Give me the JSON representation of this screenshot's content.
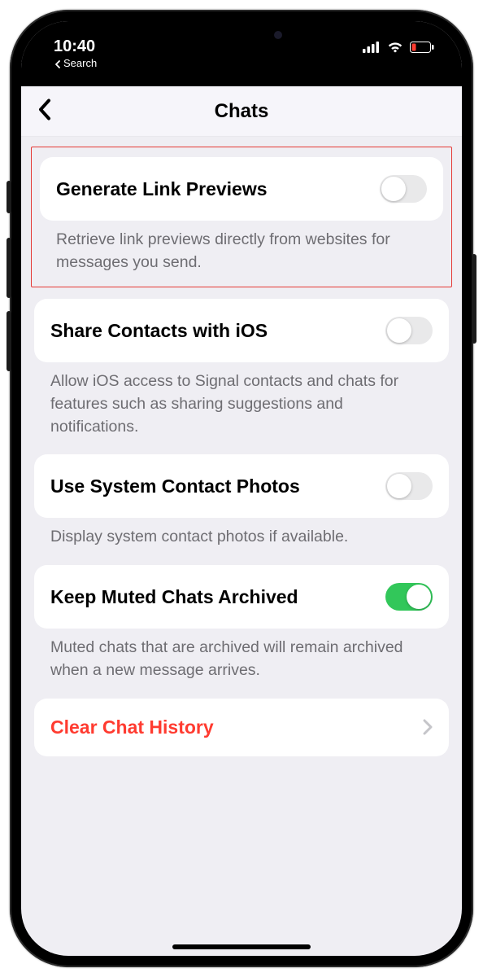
{
  "status": {
    "time": "10:40",
    "back_app_label": "Search"
  },
  "header": {
    "title": "Chats"
  },
  "settings": [
    {
      "title": "Generate Link Previews",
      "footer": "Retrieve link previews directly from websites for messages you send.",
      "enabled": false,
      "highlighted": true
    },
    {
      "title": "Share Contacts with iOS",
      "footer": "Allow iOS access to Signal contacts and chats for features such as sharing suggestions and notifications.",
      "enabled": false,
      "highlighted": false
    },
    {
      "title": "Use System Contact Photos",
      "footer": "Display system contact photos if available.",
      "enabled": false,
      "highlighted": false
    },
    {
      "title": "Keep Muted Chats Archived",
      "footer": "Muted chats that are archived will remain archived when a new message arrives.",
      "enabled": true,
      "highlighted": false
    }
  ],
  "action": {
    "label": "Clear Chat History"
  },
  "colors": {
    "destructive": "#ff3b30",
    "toggle_on": "#32c75a",
    "highlight_border": "#e53935"
  }
}
